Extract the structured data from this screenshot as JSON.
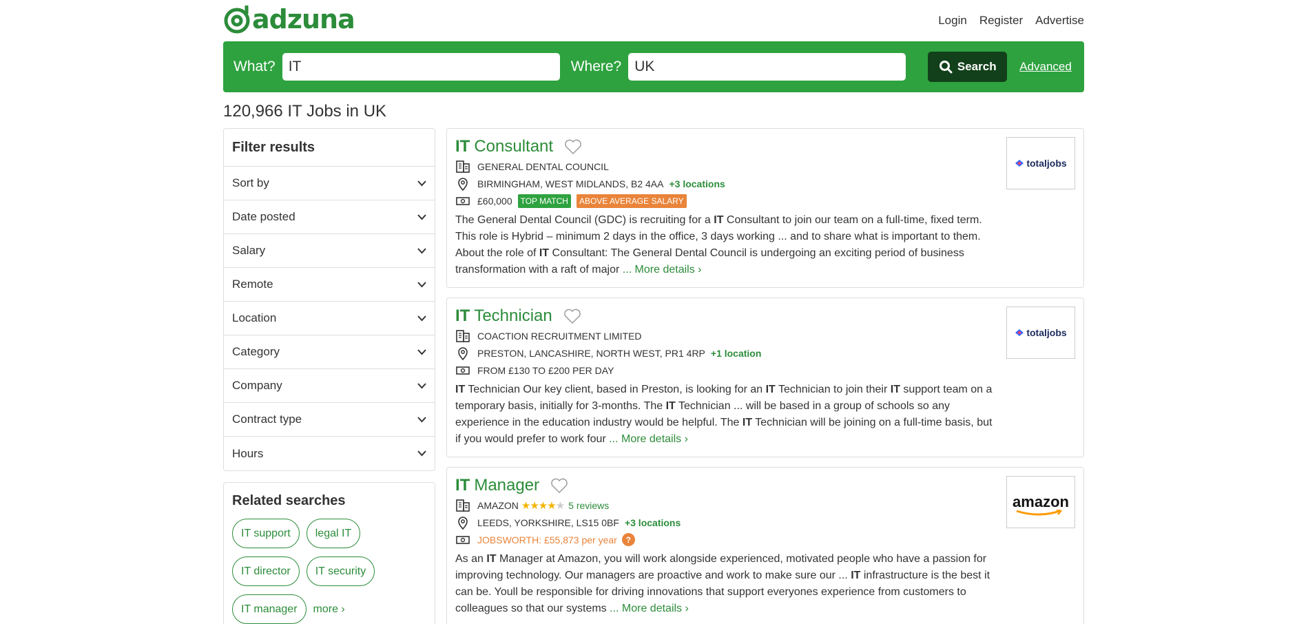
{
  "header": {
    "logo_text": "adzuna",
    "links": [
      "Login",
      "Register",
      "Advertise"
    ]
  },
  "search": {
    "what_label": "What?",
    "what_value": "IT",
    "where_label": "Where?",
    "where_value": "UK",
    "button_label": "Search",
    "advanced_label": "Advanced"
  },
  "results_title": "120,966 IT Jobs in UK",
  "filters": {
    "title": "Filter results",
    "items": [
      "Sort by",
      "Date posted",
      "Salary",
      "Remote",
      "Location",
      "Category",
      "Company",
      "Contract type",
      "Hours"
    ]
  },
  "related": {
    "title": "Related searches",
    "chips": [
      "IT support",
      "legal IT",
      "IT director",
      "IT security",
      "IT manager"
    ],
    "more_label": "more"
  },
  "jobs": [
    {
      "title_bold": "IT",
      "title_rest": "Consultant",
      "company": "GENERAL DENTAL COUNCIL",
      "location": "BIRMINGHAM, WEST MIDLANDS, B2 4AA",
      "locations_extra": "+3 locations",
      "salary": "£60,000",
      "badges": [
        "TOP MATCH",
        "ABOVE AVERAGE SALARY"
      ],
      "desc": [
        {
          "t": "The General Dental Council (GDC) is recruiting for a "
        },
        {
          "t": "IT",
          "b": true
        },
        {
          "t": " Consultant to join our team on a full-time, fixed term. This role is Hybrid – minimum 2 days in the office, 3 days working ... and to share what is important to them. About the role of "
        },
        {
          "t": "IT",
          "b": true
        },
        {
          "t": " Consultant: The General Dental Council is undergoing an exciting period of business transformation with a raft of major"
        }
      ],
      "more_details": "... More details",
      "logo": "totaljobs"
    },
    {
      "title_bold": "IT",
      "title_rest": "Technician",
      "company": "COACTION RECRUITMENT LIMITED",
      "location": "PRESTON, LANCASHIRE, NORTH WEST, PR1 4RP",
      "locations_extra": "+1 location",
      "salary": "FROM £130 TO £200 PER DAY",
      "desc": [
        {
          "t": "IT",
          "b": true
        },
        {
          "t": " Technician Our key client, based in Preston, is looking for an "
        },
        {
          "t": "IT",
          "b": true
        },
        {
          "t": " Technician to join their "
        },
        {
          "t": "IT",
          "b": true
        },
        {
          "t": " support team on a temporary basis, initially for 3-months. The "
        },
        {
          "t": "IT",
          "b": true
        },
        {
          "t": " Technician ... will be based in a group of schools so any experience in the education industry would be helpful. The "
        },
        {
          "t": "IT",
          "b": true
        },
        {
          "t": " Technician will be joining on a full-time basis, but if you would prefer to work four"
        }
      ],
      "more_details": "... More details",
      "logo": "totaljobs"
    },
    {
      "title_bold": "IT",
      "title_rest": "Manager",
      "company": "AMAZON",
      "rating_stars": 4,
      "reviews": "5 reviews",
      "location": "LEEDS, YORKSHIRE, LS15 0BF",
      "locations_extra": "+3 locations",
      "salary": "JOBSWORTH: £55,873 per year",
      "desc": [
        {
          "t": "As an "
        },
        {
          "t": "IT",
          "b": true
        },
        {
          "t": " Manager at Amazon, you will work alongside experienced, motivated people who have a passion for improving technology. Our managers are proactive and work to make sure our ... "
        },
        {
          "t": "IT",
          "b": true
        },
        {
          "t": " infrastructure is the best it can be. Youll be responsible for driving innovations that support everyones experience from customers to colleagues so that our systems"
        }
      ],
      "more_details": "... More details",
      "logo": "amazon"
    }
  ],
  "logos": {
    "totaljobs": "totaljobs",
    "amazon": "amazon"
  },
  "colors": {
    "brand_green": "#2ea23f",
    "link_green": "#2c8c3a",
    "orange": "#e9843a",
    "dark_button": "#12401a"
  }
}
